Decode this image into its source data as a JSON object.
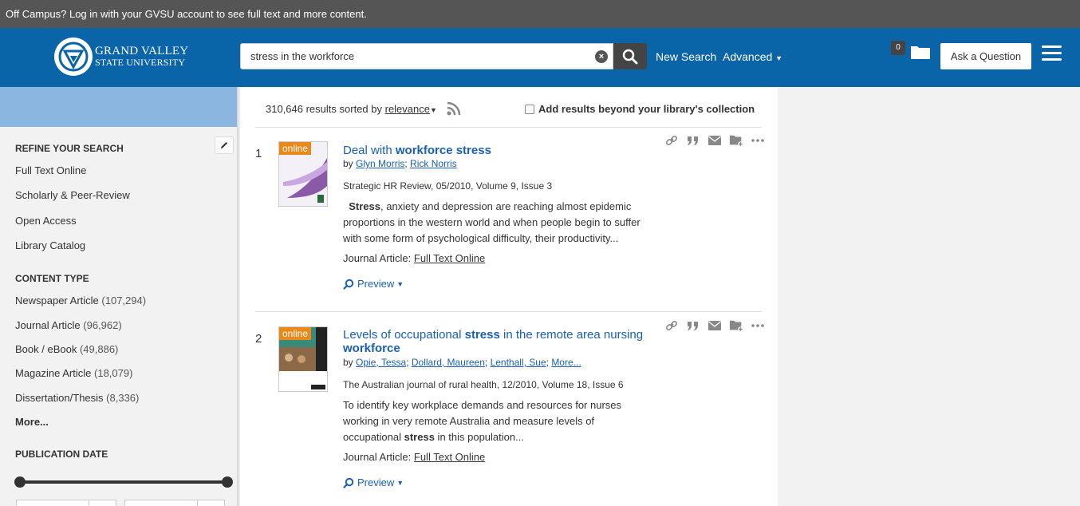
{
  "notice": "Off Campus? Log in with your GVSU account to see full text and more content.",
  "header": {
    "logo_line1": "GRAND VALLEY",
    "logo_line2": "STATE UNIVERSITY",
    "search_value": "stress in the workforce",
    "new_search": "New Search",
    "advanced": "Advanced",
    "folder_count": "0",
    "ask": "Ask a Question"
  },
  "sidebar": {
    "refine_title": "REFINE YOUR SEARCH",
    "refine_items": [
      "Full Text Online",
      "Scholarly & Peer-Review",
      "Open Access",
      "Library Catalog"
    ],
    "content_type_title": "CONTENT TYPE",
    "content_types": [
      {
        "label": "Newspaper Article",
        "count": "(107,294)"
      },
      {
        "label": "Journal Article",
        "count": "(96,962)"
      },
      {
        "label": "Book / eBook",
        "count": "(49,886)"
      },
      {
        "label": "Magazine Article",
        "count": "(18,079)"
      },
      {
        "label": "Dissertation/Thesis",
        "count": "(8,336)"
      }
    ],
    "more": "More...",
    "pub_date_title": "PUBLICATION DATE"
  },
  "results_header": {
    "count_text": "310,646 results sorted by",
    "sort": "relevance",
    "beyond": "Add results beyond your library's collection"
  },
  "results": [
    {
      "num": "1",
      "online": "online",
      "title_a": "Deal with ",
      "title_b": "workforce stress",
      "title_c": "",
      "by": "by",
      "authors": [
        "Glyn Morris",
        "Rick Norris"
      ],
      "more_authors": "",
      "source": "Strategic HR Review, 05/2010, Volume 9, Issue 3",
      "abstract_bold": "Stress",
      "abstract_rest": ", anxiety and depression are reaching almost epidemic proportions in the western world and when people begin to suffer with some form of psychological difficulty, their productivity...",
      "type_label": "Journal Article:",
      "fulltext": "Full Text Online",
      "preview": "Preview"
    },
    {
      "num": "2",
      "online": "online",
      "title_a": "Levels of occupational ",
      "title_b": "stress",
      "title_c": " in the remote area nursing ",
      "title_d": "workforce",
      "by": "by",
      "authors": [
        "Opie, Tessa",
        "Dollard, Maureen",
        "Lenthall, Sue"
      ],
      "more_authors": "More...",
      "source": "The Australian journal of rural health, 12/2010, Volume 18, Issue 6",
      "abstract_a": "To identify key workplace demands and resources for nurses working in very remote Australia and measure levels of occupational ",
      "abstract_bold": "stress",
      "abstract_c": " in this population...",
      "type_label": "Journal Article:",
      "fulltext": "Full Text Online",
      "preview": "Preview"
    }
  ],
  "colors": {
    "header": "#0a65a8",
    "notice": "#555555",
    "online_tag": "#e88a1a",
    "link": "#1a5fb4"
  }
}
